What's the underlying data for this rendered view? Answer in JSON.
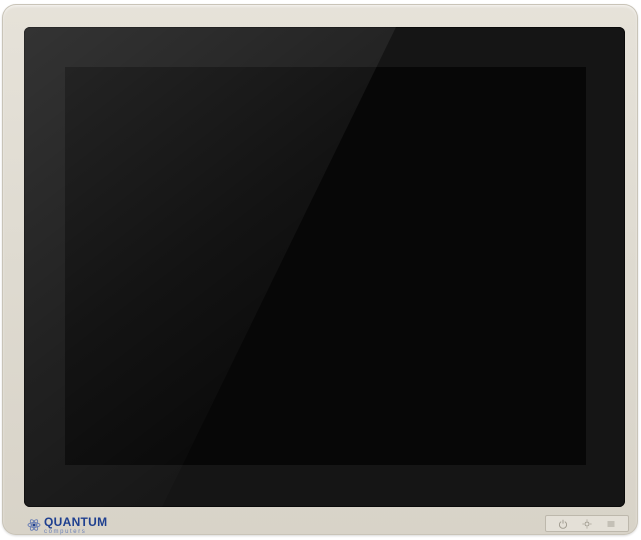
{
  "device": {
    "type": "panel-pc-monitor",
    "bezel_color": "#dfdbd1",
    "screen_color": "#070707",
    "screen_state": "off"
  },
  "logo": {
    "brand": "QUANTUM",
    "tagline": "computers",
    "brand_color": "#1e3f8f",
    "icon": "atom-logo-icon"
  },
  "controls": {
    "icons": [
      "power-icon",
      "brightness-icon",
      "menu-icon"
    ]
  }
}
